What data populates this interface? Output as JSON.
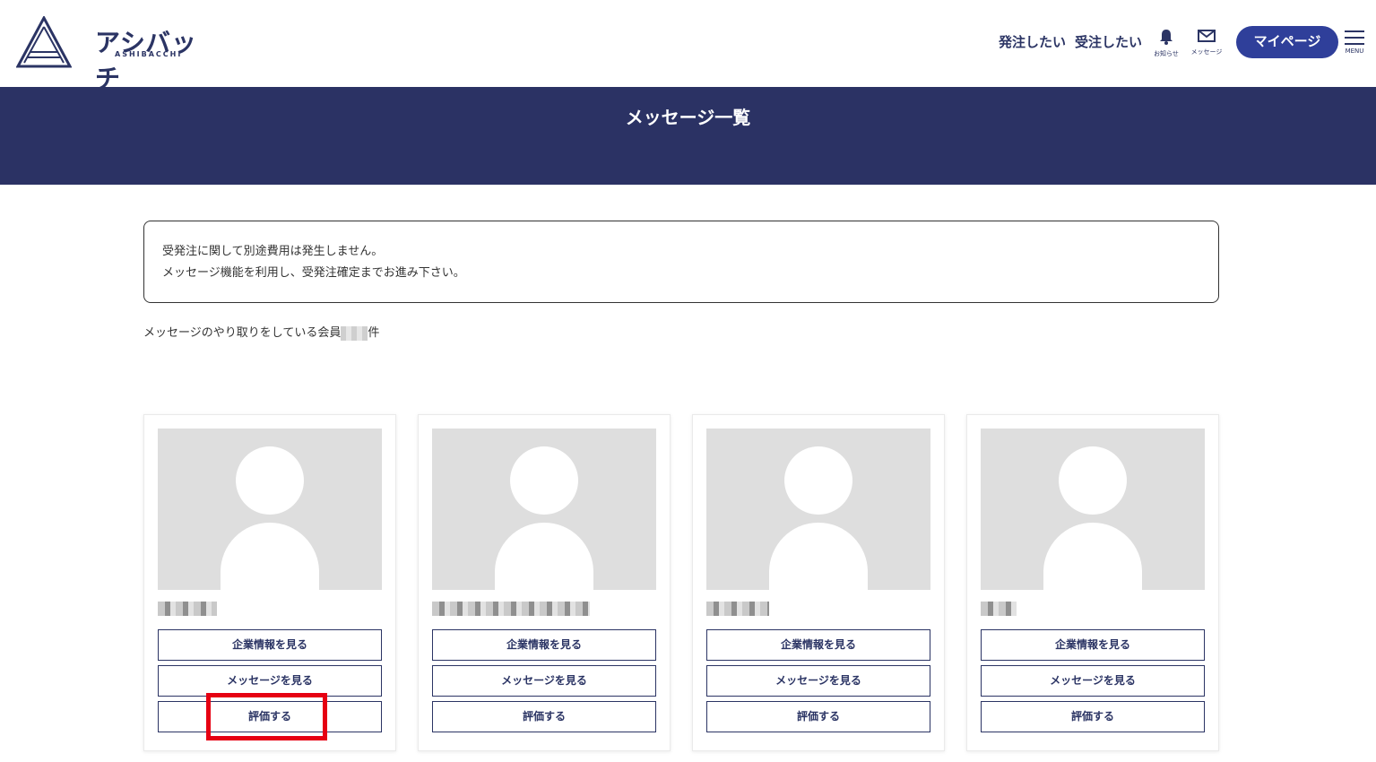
{
  "header": {
    "logo_text": "アシバッチ",
    "logo_sub": "ASHIBACCHI",
    "nav_order": "発注したい",
    "nav_receive": "受注したい",
    "notifications_caption": "お知らせ",
    "messages_caption": "メッセージ",
    "mypage_label": "マイページ",
    "menu_caption": "MENU"
  },
  "banner": {
    "title": "メッセージ一覧"
  },
  "notice": {
    "line1": "受発注に関して別途費用は発生しません。",
    "line2": "メッセージ機能を利用し、受発注確定までお進み下さい。"
  },
  "count": {
    "prefix": "メッセージのやり取りをしている会員",
    "suffix": "件"
  },
  "cards": [
    {
      "company_button": "企業情報を見る",
      "message_button": "メッセージを見る",
      "rate_button": "評価する"
    },
    {
      "company_button": "企業情報を見る",
      "message_button": "メッセージを見る",
      "rate_button": "評価する"
    },
    {
      "company_button": "企業情報を見る",
      "message_button": "メッセージを見る",
      "rate_button": "評価する"
    },
    {
      "company_button": "企業情報を見る",
      "message_button": "メッセージを見る",
      "rate_button": "評価する"
    }
  ],
  "colors": {
    "navy": "#2b3264",
    "accent": "#2f3f9a",
    "highlight": "#e60012"
  }
}
